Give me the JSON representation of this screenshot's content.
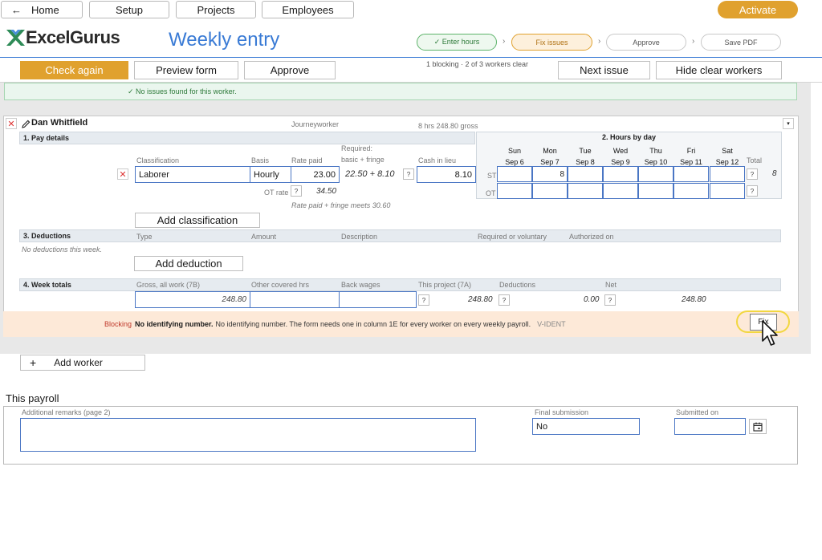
{
  "nav": {
    "home": "Home",
    "home_arrow": "←",
    "setup": "Setup",
    "projects": "Projects",
    "employees": "Employees",
    "activate": "Activate"
  },
  "brand": {
    "name": "ExcelGurus",
    "accent": "#3a7bd5",
    "logo_color": "#2e8b57"
  },
  "page_title": "Weekly entry",
  "steps": [
    {
      "label": "✓ Enter hours",
      "state": "done"
    },
    {
      "label": "Fix issues",
      "state": "current"
    },
    {
      "label": "Approve",
      "state": "pending"
    },
    {
      "label": "Save PDF",
      "state": "pending"
    }
  ],
  "step_separator": "›",
  "toolbar": {
    "check_again": "Check again",
    "preview_form": "Preview form",
    "approve": "Approve",
    "status": "1 blocking · 2 of 3 workers clear",
    "next_issue": "Next issue",
    "hide_clear": "Hide clear workers"
  },
  "clear_banner": "✓  No issues found for this worker.",
  "worker": {
    "name": "Dan Whitfield",
    "remove_glyph": "✕",
    "edit_icon": "pencil-icon",
    "role": "Journeyworker",
    "summary": "8 hrs   248.80 gross",
    "collapse_glyph": "▾",
    "pay": {
      "section": "1. Pay details",
      "col_classification": "Classification",
      "col_basis": "Basis",
      "col_rate_paid": "Rate paid",
      "col_required_1": "Required:",
      "col_required_2": "basic + fringe",
      "col_cash": "Cash in lieu",
      "classification": "Laborer",
      "basis": "Hourly",
      "rate_paid": "23.00",
      "required_value": "22.50 + 8.10",
      "cash_in_lieu": "8.10",
      "ot_rate_label": "OT rate",
      "ot_rate_value": "34.50",
      "note": "Rate paid + fringe meets 30.60",
      "add_classification": "Add classification"
    },
    "hours": {
      "section": "2. Hours by day",
      "days": [
        {
          "name": "Sun",
          "date": "Sep 6",
          "st": "",
          "ot": ""
        },
        {
          "name": "Mon",
          "date": "Sep 7",
          "st": "8",
          "ot": ""
        },
        {
          "name": "Tue",
          "date": "Sep 8",
          "st": "",
          "ot": ""
        },
        {
          "name": "Wed",
          "date": "Sep 9",
          "st": "",
          "ot": ""
        },
        {
          "name": "Thu",
          "date": "Sep 10",
          "st": "",
          "ot": ""
        },
        {
          "name": "Fri",
          "date": "Sep 11",
          "st": "",
          "ot": ""
        },
        {
          "name": "Sat",
          "date": "Sep 12",
          "st": "",
          "ot": ""
        }
      ],
      "total_label": "Total",
      "st_label": "ST",
      "ot_label": "OT",
      "st_total": "8",
      "ot_total": ""
    },
    "deductions": {
      "section": "3. Deductions",
      "col_type": "Type",
      "col_amount": "Amount",
      "col_description": "Description",
      "col_required": "Required or voluntary",
      "col_authorized": "Authorized on",
      "empty": "No deductions this week.",
      "add": "Add deduction"
    },
    "totals": {
      "section": "4. Week totals",
      "col_gross": "Gross, all work (7B)",
      "col_other_hrs": "Other covered hrs",
      "col_back_wages": "Back wages",
      "col_this_project": "This project (7A)",
      "col_deductions": "Deductions",
      "col_net": "Net",
      "gross": "248.80",
      "other_hrs": "",
      "back_wages": "",
      "this_project": "248.80",
      "deductions": "0.00",
      "net": "248.80"
    },
    "help_glyph": "?",
    "issue": {
      "severity": "Blocking",
      "title": "No identifying number.",
      "message": "No identifying number. The form needs one in column 1E for every worker on every weekly payroll.",
      "code": "V-IDENT",
      "fix": "Fix"
    }
  },
  "add_worker": {
    "plus": "+",
    "label": "Add worker"
  },
  "payroll": {
    "heading": "This payroll",
    "remarks_label": "Additional remarks (page 2)",
    "remarks": "",
    "final_label": "Final submission",
    "final_value": "No",
    "submitted_label": "Submitted on",
    "submitted_value": "",
    "calendar_icon": "calendar-icon"
  }
}
